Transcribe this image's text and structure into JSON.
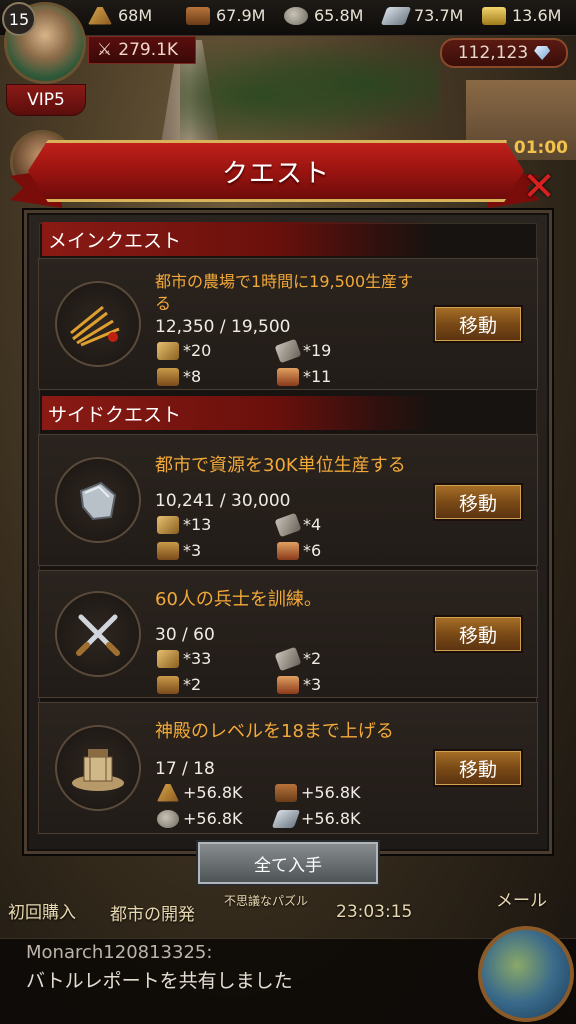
{
  "resources": {
    "food": "68M",
    "wood": "67.9M",
    "stone": "65.8M",
    "iron": "73.7M",
    "gold": "13.6M"
  },
  "player": {
    "level": "15",
    "vip": "VIP5",
    "power": "279.1K",
    "gems": "112,123"
  },
  "event_timer": "6d 01:00",
  "dialog": {
    "title": "クエスト",
    "main_section": "メインクエスト",
    "side_section": "サイドクエスト",
    "claim_all": "全て入手"
  },
  "main_quest": {
    "title": "都市の農場で1時間に19,500生産する",
    "progress": "12,350 / 19,500",
    "button": "移動",
    "rewards": [
      "*20",
      "*19",
      "*8",
      "*11"
    ]
  },
  "side_quests": [
    {
      "title": "都市で資源を30K単位生産する",
      "progress": "10,241 / 30,000",
      "button": "移動",
      "rewards": [
        "*13",
        "*4",
        "*3",
        "*6"
      ]
    },
    {
      "title": "60人の兵士を訓練。",
      "progress": "30 / 60",
      "button": "移動",
      "rewards": [
        "*33",
        "*2",
        "*2",
        "*3"
      ]
    },
    {
      "title": "神殿のレベルを18まで上げる",
      "progress": "17 / 18",
      "button": "移動",
      "rewards": [
        "+56.8K",
        "+56.8K",
        "+56.8K",
        "+56.8K"
      ]
    }
  ],
  "bottom_nav": {
    "first_purchase": "初回購入",
    "city_dev": "都市の開発",
    "puzzle": "不思議なパズル",
    "time": "23:03:15",
    "mail": "メール"
  },
  "chat": {
    "user": "Monarch120813325:",
    "message": "バトルレポートを共有しました"
  }
}
